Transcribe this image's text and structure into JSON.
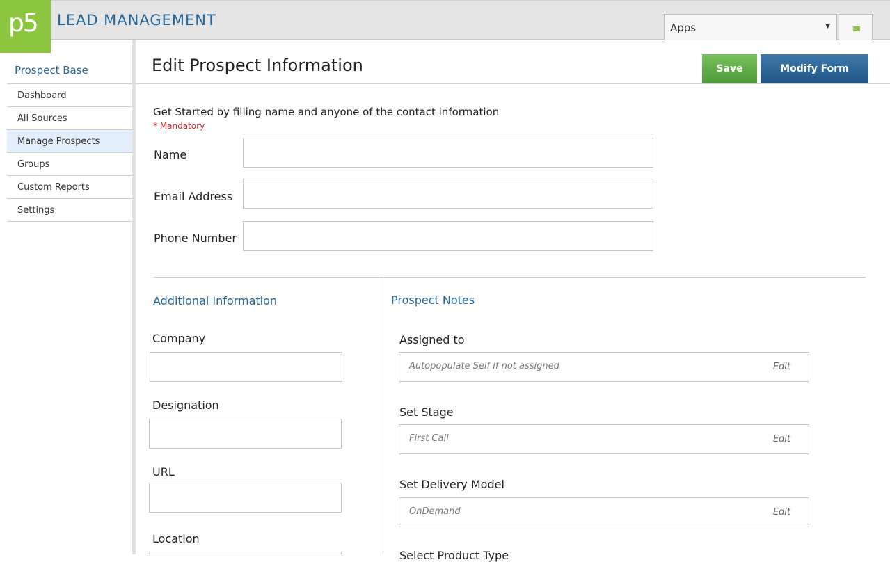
{
  "header": {
    "logo_text": "p5",
    "app_title": "LEAD MANAGEMENT",
    "apps_select": {
      "value": "Apps"
    },
    "accent_color": "#8cc63f"
  },
  "sidebar": {
    "title": "Prospect Base",
    "items": [
      {
        "label": "Dashboard"
      },
      {
        "label": "All Sources"
      },
      {
        "label": "Manage Prospects",
        "active": true
      },
      {
        "label": "Groups"
      },
      {
        "label": "Custom Reports"
      },
      {
        "label": "Settings"
      }
    ]
  },
  "page": {
    "title": "Edit Prospect Information",
    "save_label": "Save",
    "modify_label": "Modify Form",
    "intro": "Get Started by filling name and anyone of the contact information",
    "mandatory": "* Mandatory"
  },
  "contact_fields": {
    "name_label": "Name",
    "name_value": "",
    "email_label": "Email Address",
    "email_value": "",
    "phone_label": "Phone Number",
    "phone_value": ""
  },
  "additional": {
    "heading": "Additional Information",
    "company_label": "Company",
    "designation_label": "Designation",
    "url_label": "URL",
    "location_label": "Location"
  },
  "notes": {
    "heading": "Prospect Notes",
    "assigned_label": "Assigned to",
    "assigned_value": "Autopopulate Self if not assigned",
    "stage_label": "Set Stage",
    "stage_value": "First Call",
    "delivery_label": "Set Delivery Model",
    "delivery_value": "OnDemand",
    "product_label": "Select Product Type",
    "edit_label": "Edit"
  }
}
